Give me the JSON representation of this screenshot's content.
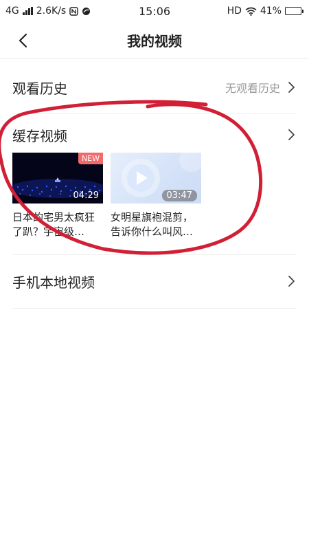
{
  "status_bar": {
    "network": "4G",
    "speed": "2.6K/s",
    "time": "15:06",
    "hd": "HD",
    "battery": "41%",
    "battery_level": 0.41
  },
  "navbar": {
    "title": "我的视频",
    "back_icon": "chevron-left-icon"
  },
  "history": {
    "title": "观看历史",
    "meta": "无观看历史"
  },
  "cache": {
    "title": "缓存视频",
    "videos": [
      {
        "title": "日本的宅男太疯狂了趴？宇宙级…",
        "duration": "04:29",
        "badge": "NEW"
      },
      {
        "title": "女明星旗袍混剪，告诉你什么叫风…",
        "duration": "03:47",
        "badge": ""
      }
    ]
  },
  "local": {
    "title": "手机本地视频"
  },
  "colors": {
    "accent_badge": "#f26a6a",
    "annotation": "#d11f35",
    "meta_text": "#9a9a9a"
  }
}
